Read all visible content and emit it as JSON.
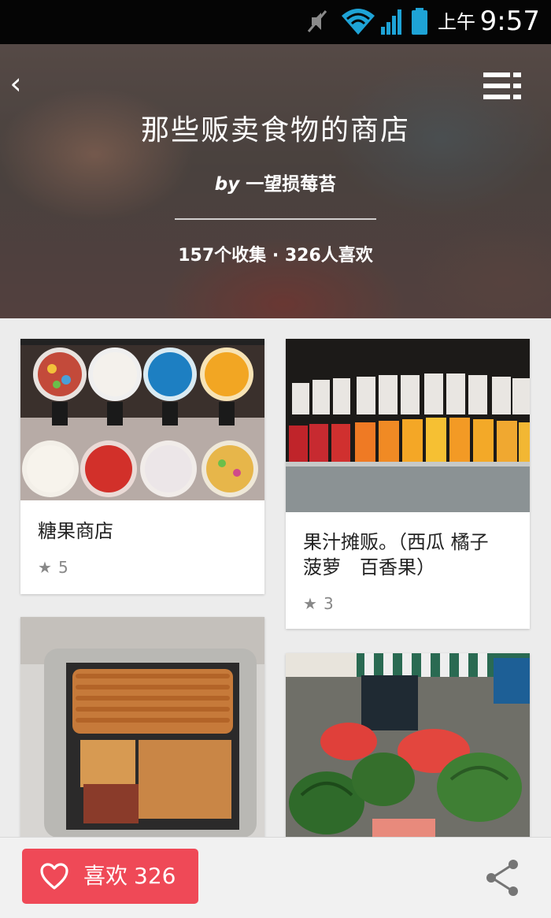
{
  "status_bar": {
    "ampm": "上午",
    "time": "9:57",
    "icons": [
      "mute-icon",
      "wifi-icon",
      "signal-icon",
      "battery-icon"
    ]
  },
  "header": {
    "title": "那些贩卖食物的商店",
    "author_prefix": "by",
    "author": "一望损莓苔",
    "stats": "157个收集 · 326人喜欢"
  },
  "cards": [
    {
      "title": "糖果商店",
      "rating": "5",
      "image": "candy-gumball-machines"
    },
    {
      "title": "果汁摊贩。（西瓜 橘子 菠萝　百香果）",
      "rating": "3",
      "image": "juice-stall-bottles"
    },
    {
      "title": "",
      "rating": "",
      "image": "bread-van"
    },
    {
      "title": "",
      "rating": "",
      "image": "watermelon-market"
    }
  ],
  "bottom_bar": {
    "like_label": "喜欢",
    "like_count": "326"
  },
  "colors": {
    "accent": "#ef4957",
    "background": "#ececec",
    "status_bar": "#050505"
  }
}
